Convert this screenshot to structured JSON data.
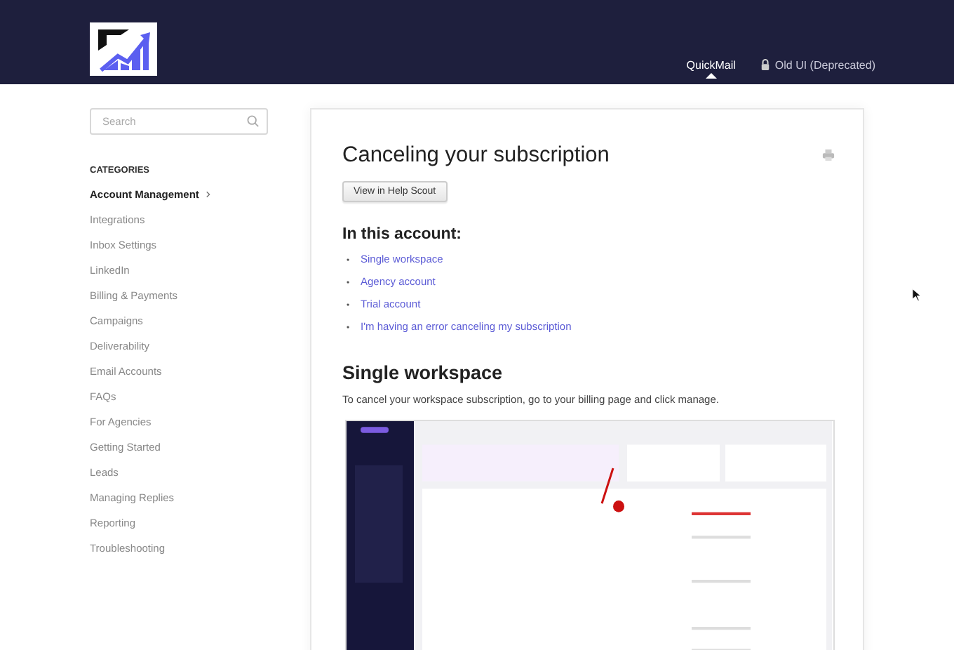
{
  "header": {
    "nav": [
      {
        "label": "QuickMail",
        "selected": true,
        "locked": false
      },
      {
        "label": "Old UI (Deprecated)",
        "selected": false,
        "locked": true
      }
    ]
  },
  "sidebar": {
    "search": {
      "placeholder": "Search"
    },
    "heading": "CATEGORIES",
    "items": [
      {
        "label": "Account Management",
        "selected": true
      },
      {
        "label": "Integrations",
        "selected": false
      },
      {
        "label": "Inbox Settings",
        "selected": false
      },
      {
        "label": "LinkedIn",
        "selected": false
      },
      {
        "label": "Billing & Payments",
        "selected": false
      },
      {
        "label": "Campaigns",
        "selected": false
      },
      {
        "label": "Deliverability",
        "selected": false
      },
      {
        "label": "Email Accounts",
        "selected": false
      },
      {
        "label": "FAQs",
        "selected": false
      },
      {
        "label": "For Agencies",
        "selected": false
      },
      {
        "label": "Getting Started",
        "selected": false
      },
      {
        "label": "Leads",
        "selected": false
      },
      {
        "label": "Managing Replies",
        "selected": false
      },
      {
        "label": "Reporting",
        "selected": false
      },
      {
        "label": "Troubleshooting",
        "selected": false
      }
    ]
  },
  "article": {
    "title": "Canceling your subscription",
    "button": "View in Help Scout",
    "toc_heading": "In this account:",
    "bullet": "•",
    "toc": [
      "Single workspace",
      "Agency account",
      "Trial account",
      "I'm having an error canceling my subscription"
    ],
    "section_heading": "Single workspace",
    "paragraph": "To cancel your workspace subscription, go to your billing page and click manage."
  }
}
